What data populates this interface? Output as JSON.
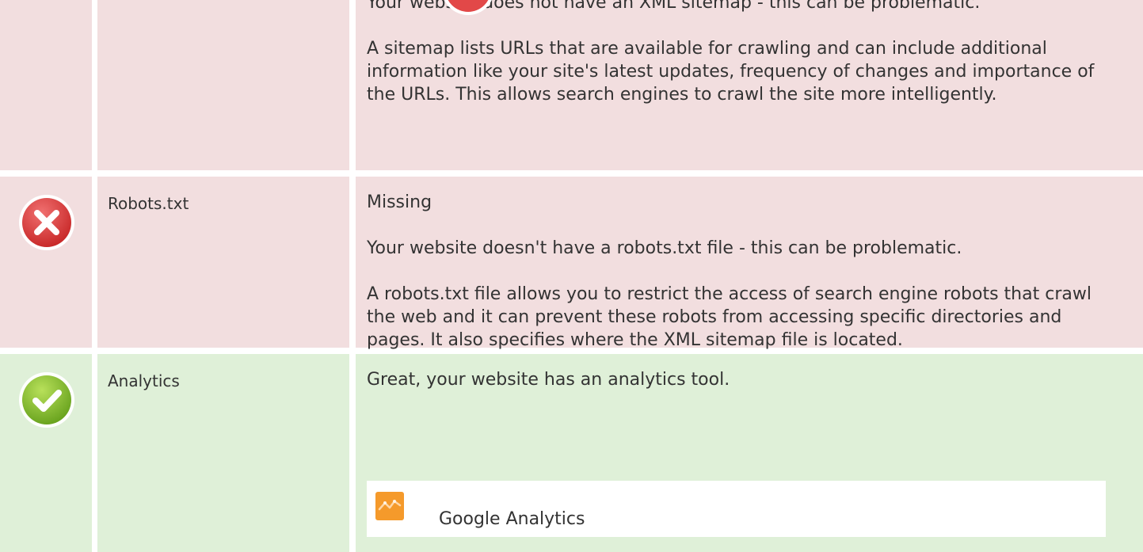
{
  "rows": {
    "sitemap": {
      "status": "bad",
      "paragraphs": [
        "Your website does not have an XML sitemap - this can be problematic.",
        "A sitemap lists URLs that are available for crawling and can include additional information like your site's latest updates, frequency of changes and importance of the URLs. This allows search engines to crawl the site more intelligently."
      ]
    },
    "robots": {
      "status": "bad",
      "label": "Robots.txt",
      "value": "Missing",
      "paragraphs": [
        "Your website doesn't have a robots.txt file - this can be problematic.",
        "A robots.txt file allows you to restrict the access of search engine robots that crawl the web and it can prevent these robots from accessing specific directories and pages. It also specifies where the XML sitemap file is located."
      ]
    },
    "analytics": {
      "status": "good",
      "label": "Analytics",
      "summary": "Great, your website has an analytics tool.",
      "tool": {
        "name": "Google Analytics",
        "icon": "google-analytics-icon"
      }
    }
  },
  "colors": {
    "bad_row": "#f2dedf",
    "good_row": "#dff0d8",
    "error_icon": "#e24848",
    "success_icon": "#8cc63f",
    "analytics_icon": "#f59a2b"
  },
  "icons": {
    "error": "error-x-icon",
    "success": "success-check-icon"
  }
}
